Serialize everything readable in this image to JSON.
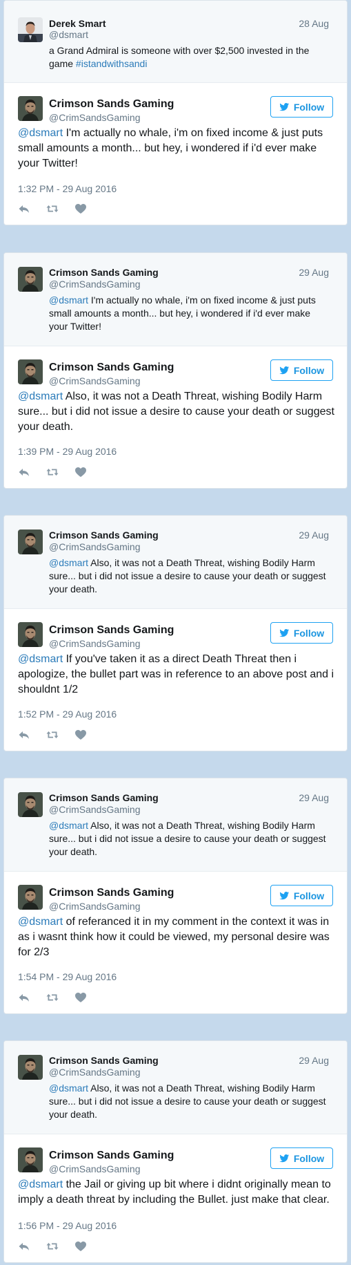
{
  "colors": {
    "background": "#c5d9ec",
    "link": "#2b7bb9",
    "follow": "#1da1f2",
    "quoted_background": "#f5f8fa"
  },
  "icons": {
    "follow": "twitter-bird-icon",
    "reply": "reply-icon",
    "retweet": "retweet-icon",
    "like": "heart-icon"
  },
  "follow_label": "Follow",
  "cards": [
    {
      "quoted": {
        "name": "Derek Smart",
        "handle": "@dsmart",
        "date": "28 Aug",
        "text": "a Grand Admiral is someone with over $2,500 invested in the game ",
        "hashtag": "#istandwithsandi"
      },
      "main": {
        "name": "Crimson Sands Gaming",
        "handle": "@CrimSandsGaming",
        "mention": "@dsmart",
        "text": " I'm actually no whale, i'm on fixed income & just puts small amounts a month... but hey, i wondered if i'd ever make your Twitter!",
        "time": "1:32 PM - 29 Aug 2016"
      }
    },
    {
      "quoted": {
        "name": "Crimson Sands Gaming",
        "handle": "@CrimSandsGaming",
        "date": "29 Aug",
        "mention": "@dsmart",
        "text": " I'm actually no whale, i'm on fixed income & just puts small amounts a month... but hey, i wondered if i'd ever make your Twitter!"
      },
      "main": {
        "name": "Crimson Sands Gaming",
        "handle": "@CrimSandsGaming",
        "mention": "@dsmart",
        "text": " Also, it was not a Death Threat, wishing Bodily Harm sure... but i did not issue a desire to cause your death or suggest your death.",
        "time": "1:39 PM - 29 Aug 2016"
      }
    },
    {
      "quoted": {
        "name": "Crimson Sands Gaming",
        "handle": "@CrimSandsGaming",
        "date": "29 Aug",
        "mention": "@dsmart",
        "text": " Also, it was not a Death Threat, wishing Bodily Harm sure... but i did not issue a desire to cause your death or suggest your death."
      },
      "main": {
        "name": "Crimson Sands Gaming",
        "handle": "@CrimSandsGaming",
        "mention": "@dsmart",
        "text": " If you've taken it as a direct Death Threat then i apologize, the bullet part was in reference to an above post and i shouldnt 1/2",
        "time": "1:52 PM - 29 Aug 2016"
      }
    },
    {
      "quoted": {
        "name": "Crimson Sands Gaming",
        "handle": "@CrimSandsGaming",
        "date": "29 Aug",
        "mention": "@dsmart",
        "text": " Also, it was not a Death Threat, wishing Bodily Harm sure... but i did not issue a desire to cause your death or suggest your death."
      },
      "main": {
        "name": "Crimson Sands Gaming",
        "handle": "@CrimSandsGaming",
        "mention": "@dsmart",
        "text": " of referanced it in my comment in the context it was in as i wasnt think how it could be viewed, my personal desire was for 2/3",
        "time": "1:54 PM - 29 Aug 2016"
      }
    },
    {
      "quoted": {
        "name": "Crimson Sands Gaming",
        "handle": "@CrimSandsGaming",
        "date": "29 Aug",
        "mention": "@dsmart",
        "text": " Also, it was not a Death Threat, wishing Bodily Harm sure... but i did not issue a desire to cause your death or suggest your death."
      },
      "main": {
        "name": "Crimson Sands Gaming",
        "handle": "@CrimSandsGaming",
        "mention": "@dsmart",
        "text": " the Jail or giving up bit where i didnt originally mean to imply a death threat by including the Bullet. just make that clear.",
        "time": "1:56 PM - 29 Aug 2016"
      }
    }
  ]
}
